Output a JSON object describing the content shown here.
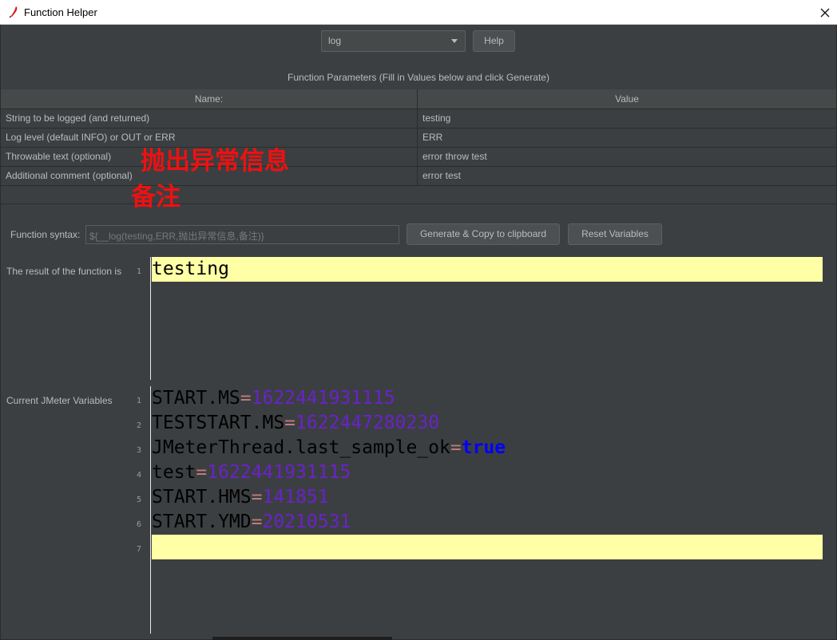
{
  "window": {
    "title": "Function Helper",
    "close_symbol": "✕"
  },
  "toolbar": {
    "selected_function": "log",
    "help_label": "Help"
  },
  "parameters": {
    "caption": "Function Parameters (Fill in Values below and click Generate)",
    "headers": {
      "name": "Name:",
      "value": "Value"
    },
    "rows": [
      {
        "name": "String to be logged (and returned)",
        "value": "testing"
      },
      {
        "name": "Log level (default INFO) or OUT or ERR",
        "value": "ERR"
      },
      {
        "name": "Throwable text (optional)",
        "value": "error throw test"
      },
      {
        "name": "Additional comment (optional)",
        "value": "error test"
      }
    ]
  },
  "annotations": {
    "throwable_note": "抛出异常信息",
    "comment_note": "备注"
  },
  "syntax": {
    "label": "Function syntax:",
    "value": "${__log(testing,ERR,抛出异常信息,备注)}",
    "generate_label": "Generate & Copy to clipboard",
    "reset_label": "Reset Variables"
  },
  "result": {
    "label": "The result of the function is",
    "lines": [
      {
        "num": "1",
        "text": "testing"
      }
    ]
  },
  "variables": {
    "label": "Current JMeter Variables",
    "lines": [
      {
        "num": "1",
        "key": "START.MS",
        "eq": "=",
        "value": "1622441931115"
      },
      {
        "num": "2",
        "key": "TESTSTART.MS",
        "eq": "=",
        "value": "1622447280230"
      },
      {
        "num": "3",
        "key": "JMeterThread.last_sample_ok",
        "eq": "=",
        "value": "true"
      },
      {
        "num": "4",
        "key": "test",
        "eq": "=",
        "value": "1622441931115"
      },
      {
        "num": "5",
        "key": "START.HMS",
        "eq": "=",
        "value": "141851"
      },
      {
        "num": "6",
        "key": "START.YMD",
        "eq": "=",
        "value": "20210531"
      },
      {
        "num": "7"
      }
    ]
  },
  "colors": {
    "background": "#3c3f41",
    "highlight_line": "#ffffa6",
    "number_literal": "#6a22c9",
    "keyword": "#0000ff",
    "annotation": "#ee1111"
  }
}
